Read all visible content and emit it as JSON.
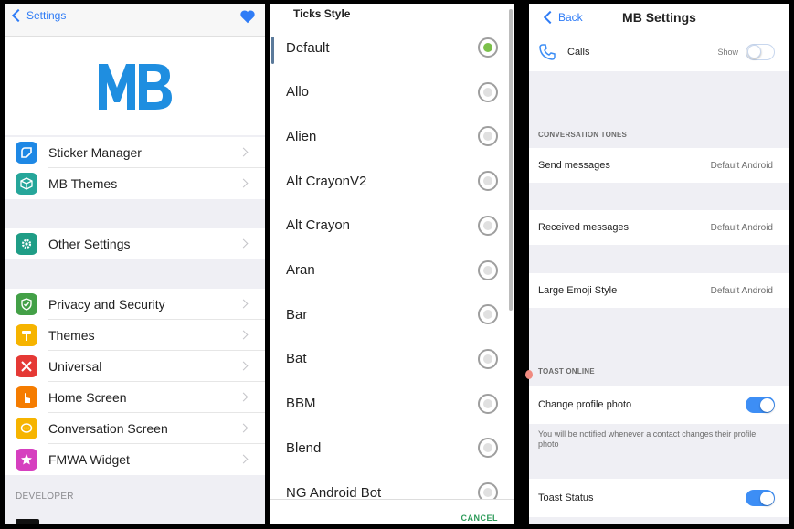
{
  "panel1": {
    "back_label": "Settings",
    "logo_text": "MB",
    "group1": [
      {
        "label": "Sticker Manager",
        "icon": "sticker-icon",
        "color": "#1e88e5"
      },
      {
        "label": "MB Themes",
        "icon": "themes-cube-icon",
        "color": "#26a69a"
      }
    ],
    "group2": [
      {
        "label": "Other Settings",
        "icon": "gear-icon",
        "color": "#1f9d86"
      }
    ],
    "group3": [
      {
        "label": "Privacy and Security",
        "icon": "shield-icon",
        "color": "#43a047"
      },
      {
        "label": "Themes",
        "icon": "paint-roller-icon",
        "color": "#f6b400"
      },
      {
        "label": "Universal",
        "icon": "tools-icon",
        "color": "#e53935"
      },
      {
        "label": "Home Screen",
        "icon": "hand-pointer-icon",
        "color": "#f57c00"
      },
      {
        "label": "Conversation Screen",
        "icon": "chat-bubble-icon",
        "color": "#f6b400"
      },
      {
        "label": "FMWA Widget",
        "icon": "star-icon",
        "color": "#d63fbf"
      }
    ],
    "developer_label": "DEVELOPER"
  },
  "panel2": {
    "title": "Ticks Style",
    "options": [
      "Default",
      "Allo",
      "Alien",
      "Alt CrayonV2",
      "Alt Crayon",
      "Aran",
      "Bar",
      "Bat",
      "BBM",
      "Blend",
      "NG Android Bot"
    ],
    "selected": "Default",
    "cancel_label": "CANCEL"
  },
  "panel3": {
    "back_label": "Back",
    "title": "MB Settings",
    "calls_label": "Calls",
    "calls_show_label": "Show",
    "calls_toggle": false,
    "section_tones": "CONVERSATION TONES",
    "send_label": "Send messages",
    "send_value": "Default Android",
    "received_label": "Received messages",
    "received_value": "Default Android",
    "emoji_label": "Large Emoji Style",
    "emoji_value": "Default Android",
    "section_toast": "TOAST ONLINE",
    "profile_label": "Change profile photo",
    "profile_toggle": true,
    "profile_note": "You will be notified whenever a contact changes their profile photo",
    "status_label": "Toast Status",
    "status_toggle": true
  },
  "colors": {
    "accent_blue": "#2f7cf6",
    "logo_blue": "#1f8ee0",
    "toggle_on": "#3d8ef5",
    "radio_selected": "#7bc04a",
    "cancel_green": "#2d9b59"
  }
}
